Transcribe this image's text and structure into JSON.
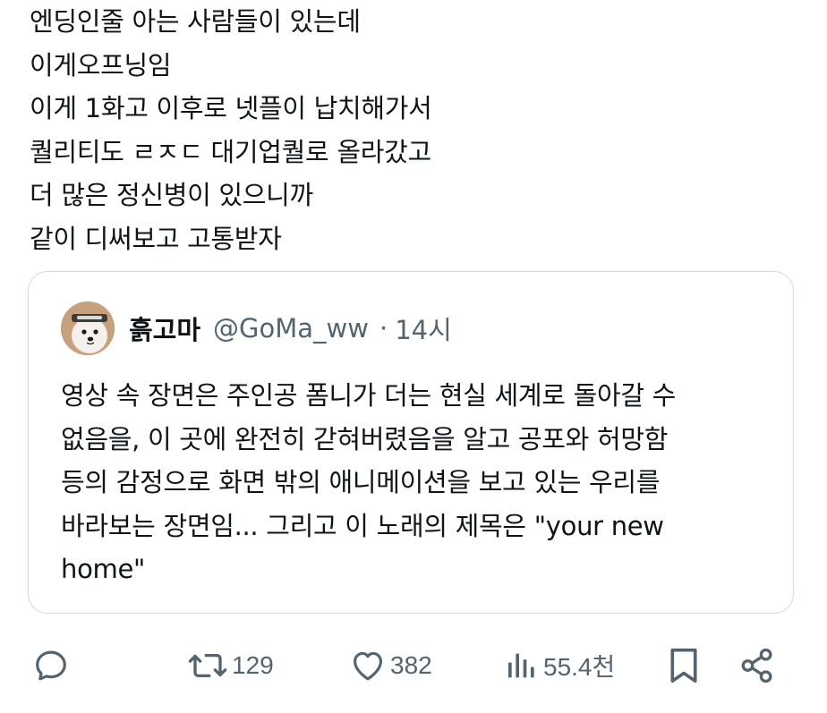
{
  "tweet": {
    "lines": [
      "엔딩인줄 아는 사람들이 있는데",
      "이게오프닝임",
      "이게 1화고 이후로 넷플이 납치해가서",
      "퀄리티도 ㄹㅈㄷ 대기업퀄로 올라갔고",
      "더 많은 정신병이 있으니까",
      "같이 디써보고 고통받자"
    ]
  },
  "quote": {
    "display_name": "흙고마",
    "handle": "@GoMa_ww",
    "separator": "·",
    "time": "14시",
    "lines": [
      "영상 속 장면은 주인공 폼니가 더는 현실 세계로 돌아갈 수",
      "없음을, 이 곳에 완전히 갇혀버렸음을 알고 공포와 허망함",
      "등의 감정으로 화면 밖의 애니메이션을 보고 있는 우리를",
      "바라보는 장면임... 그리고 이 노래의 제목은 \"your new",
      "home\""
    ]
  },
  "actions": {
    "reply_icon": "reply-icon",
    "retweet_count": "129",
    "like_count": "382",
    "views_count": "55.4천",
    "bookmark_icon": "bookmark-icon",
    "share_icon": "share-icon"
  },
  "colors": {
    "text": "#0f1419",
    "secondary": "#536471",
    "border": "#cfd9de"
  }
}
